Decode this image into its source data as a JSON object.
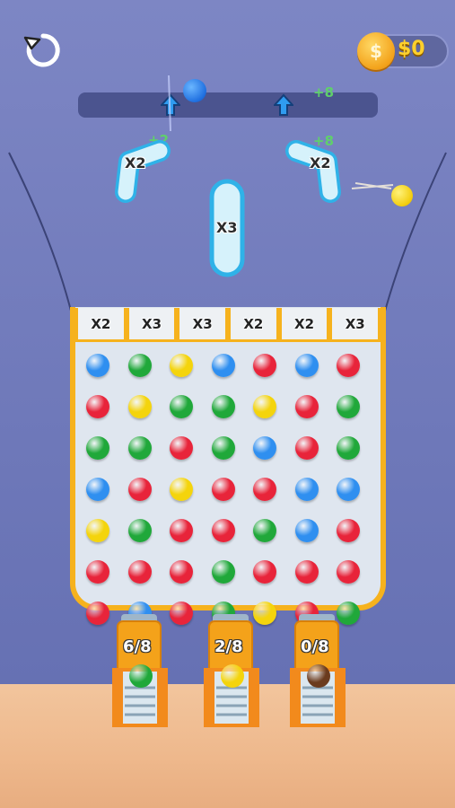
{
  "hud": {
    "restart_icon": "restart-icon",
    "coin_icon": "coin-icon",
    "coin_symbol": "$",
    "coin_amount": "$0"
  },
  "rail": {
    "bonuses": [
      "+8",
      "+2",
      "+8"
    ],
    "arrow_icon": "up-arrow-icon"
  },
  "bumpers": [
    {
      "label": "X2",
      "color": "#bfe8f7"
    },
    {
      "label": "X2",
      "color": "#bfe8f7"
    },
    {
      "label": "X3",
      "color": "#bfe8f7"
    }
  ],
  "board": {
    "slots": [
      "X2",
      "X3",
      "X3",
      "X2",
      "X2",
      "X3"
    ],
    "peg_colors": {
      "b": "#2f8ff0",
      "g": "#20a83a",
      "y": "#f4d40c",
      "r": "#e8243a"
    },
    "rows": [
      [
        "b",
        "g",
        "y",
        "b",
        "r",
        "b",
        "r"
      ],
      [
        "r",
        "y",
        "g",
        "g",
        "y",
        "r",
        "g"
      ],
      [
        "g",
        "g",
        "r",
        "g",
        "b",
        "r",
        "g"
      ],
      [
        "b",
        "r",
        "y",
        "r",
        "r",
        "b",
        "b"
      ],
      [
        "y",
        "g",
        "r",
        "r",
        "g",
        "b",
        "r"
      ],
      [
        "r",
        "r",
        "r",
        "g",
        "r",
        "r",
        "r"
      ],
      [
        "r",
        "b",
        "r",
        "g",
        "y",
        "r",
        "g"
      ]
    ]
  },
  "tubes": [
    {
      "label": "6/8",
      "ball_color": "#20a83a"
    },
    {
      "label": "2/8",
      "ball_color": "#f4d40c"
    },
    {
      "label": "0/8",
      "ball_color": "#6b3b1e"
    }
  ]
}
